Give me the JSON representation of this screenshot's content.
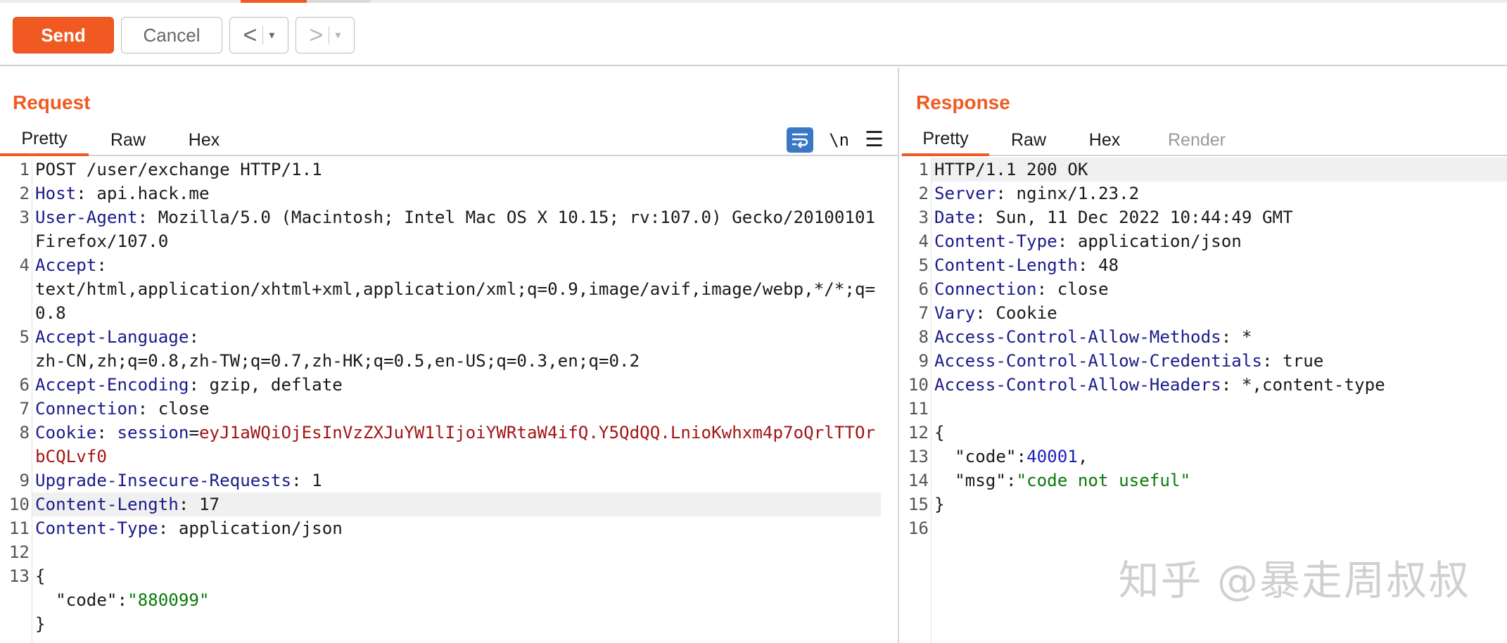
{
  "toolbar": {
    "send_label": "Send",
    "cancel_label": "Cancel",
    "back_arrow": "<",
    "forward_arrow": ">",
    "dropdown_caret": "▾"
  },
  "request": {
    "title": "Request",
    "tabs": [
      {
        "label": "Pretty",
        "active": true
      },
      {
        "label": "Raw",
        "active": false
      },
      {
        "label": "Hex",
        "active": false
      }
    ],
    "newline_toggle": "\\n",
    "lines": [
      {
        "n": "1",
        "name": "",
        "rest": "POST /user/exchange HTTP/1.1"
      },
      {
        "n": "2",
        "name": "Host",
        "rest": ": api.hack.me"
      },
      {
        "n": "3",
        "name": "User-Agent",
        "rest": ": Mozilla/5.0 (Macintosh; Intel Mac OS X 10.15; rv:107.0) Gecko/20100101 Firefox/107.0"
      },
      {
        "n": "4",
        "name": "Accept",
        "rest": ":\ntext/html,application/xhtml+xml,application/xml;q=0.9,image/avif,image/webp,*/*;q=0.8"
      },
      {
        "n": "5",
        "name": "Accept-Language",
        "rest": ":\nzh-CN,zh;q=0.8,zh-TW;q=0.7,zh-HK;q=0.5,en-US;q=0.3,en;q=0.2"
      },
      {
        "n": "6",
        "name": "Accept-Encoding",
        "rest": ": gzip, deflate"
      },
      {
        "n": "7",
        "name": "Connection",
        "rest": ": close"
      },
      {
        "n": "8",
        "name": "Cookie",
        "rest": ": ",
        "cookie_name": "session",
        "cookie_eq": "=",
        "cookie_value": "eyJ1aWQiOjEsInVzZXJuYW1lIjoiYWRtaW4ifQ.Y5QdQQ.LnioKwhxm4p7oQrlTTOrbCQLvf0"
      },
      {
        "n": "9",
        "name": "Upgrade-Insecure-Requests",
        "rest": ": 1"
      },
      {
        "n": "10",
        "name": "Content-Length",
        "rest": ": 17",
        "highlight": true
      },
      {
        "n": "11",
        "name": "Content-Type",
        "rest": ": application/json"
      },
      {
        "n": "12",
        "name": "",
        "rest": ""
      },
      {
        "n": "13",
        "name": "",
        "rest": "{"
      },
      {
        "n": "",
        "name": "",
        "rest": "  ",
        "json_key": "\"code\"",
        "json_colon": ":",
        "json_str": "\"880099\""
      },
      {
        "n": "",
        "name": "",
        "rest": "}"
      }
    ]
  },
  "response": {
    "title": "Response",
    "tabs": [
      {
        "label": "Pretty",
        "active": true
      },
      {
        "label": "Raw",
        "active": false
      },
      {
        "label": "Hex",
        "active": false
      },
      {
        "label": "Render",
        "active": false,
        "disabled": true
      }
    ],
    "lines": [
      {
        "n": "1",
        "name": "",
        "rest": "HTTP/1.1 200 OK",
        "highlight": true
      },
      {
        "n": "2",
        "name": "Server",
        "rest": ": nginx/1.23.2"
      },
      {
        "n": "3",
        "name": "Date",
        "rest": ": Sun, 11 Dec 2022 10:44:49 GMT"
      },
      {
        "n": "4",
        "name": "Content-Type",
        "rest": ": application/json"
      },
      {
        "n": "5",
        "name": "Content-Length",
        "rest": ": 48"
      },
      {
        "n": "6",
        "name": "Connection",
        "rest": ": close"
      },
      {
        "n": "7",
        "name": "Vary",
        "rest": ": Cookie"
      },
      {
        "n": "8",
        "name": "Access-Control-Allow-Methods",
        "rest": ": *"
      },
      {
        "n": "9",
        "name": "Access-Control-Allow-Credentials",
        "rest": ": true"
      },
      {
        "n": "10",
        "name": "Access-Control-Allow-Headers",
        "rest": ": *,content-type"
      },
      {
        "n": "11",
        "name": "",
        "rest": ""
      },
      {
        "n": "12",
        "name": "",
        "rest": "{"
      },
      {
        "n": "13",
        "name": "",
        "rest": "  ",
        "json_key": "\"code\"",
        "json_colon": ":",
        "json_num": "40001",
        "json_tail": ","
      },
      {
        "n": "14",
        "name": "",
        "rest": "  ",
        "json_key": "\"msg\"",
        "json_colon": ":",
        "json_str": "\"code not useful\""
      },
      {
        "n": "15",
        "name": "",
        "rest": "}"
      },
      {
        "n": "16",
        "name": "",
        "rest": ""
      }
    ]
  },
  "watermark": "知乎 @暴走周叔叔",
  "colors": {
    "accent": "#f05a22",
    "header_name": "#1b1b8a",
    "cookie_value": "#a31515",
    "json_string": "#0a7a0a",
    "json_number": "#1f1fbd",
    "wrap_icon_bg": "#3a78c4"
  }
}
